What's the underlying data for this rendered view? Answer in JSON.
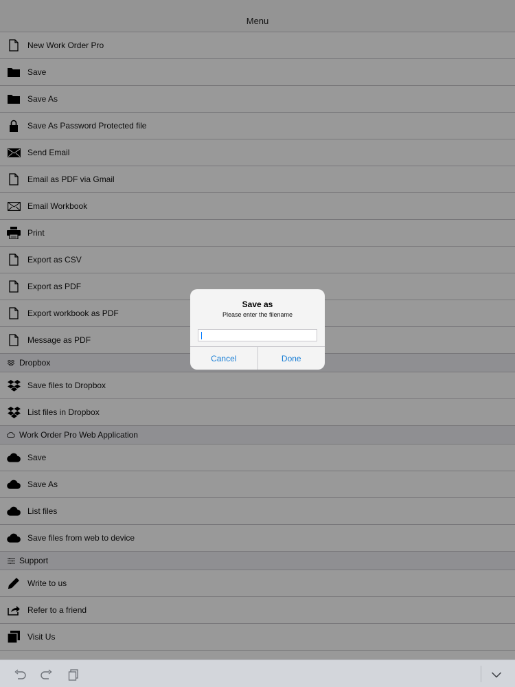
{
  "navbar": {
    "title": "Menu"
  },
  "menu": {
    "items": [
      {
        "label": "New Work Order Pro",
        "icon": "document-icon"
      },
      {
        "label": "Save",
        "icon": "folder-icon"
      },
      {
        "label": "Save As",
        "icon": "folder-icon"
      },
      {
        "label": "Save As Password Protected file",
        "icon": "lock-icon"
      },
      {
        "label": "Send Email",
        "icon": "envelope-filled-icon"
      },
      {
        "label": "Email as PDF via Gmail",
        "icon": "document-icon"
      },
      {
        "label": "Email Workbook",
        "icon": "envelope-outline-icon"
      },
      {
        "label": "Print",
        "icon": "printer-icon"
      },
      {
        "label": "Export as CSV",
        "icon": "document-icon"
      },
      {
        "label": "Export as PDF",
        "icon": "document-icon"
      },
      {
        "label": "Export workbook as PDF",
        "icon": "document-icon"
      },
      {
        "label": "Message as PDF",
        "icon": "document-icon"
      }
    ]
  },
  "dropbox": {
    "header": "Dropbox",
    "items": [
      {
        "label": "Save files to Dropbox",
        "icon": "dropbox-icon"
      },
      {
        "label": "List files in Dropbox",
        "icon": "dropbox-icon"
      }
    ]
  },
  "web": {
    "header": "Work Order Pro Web Application",
    "items": [
      {
        "label": "Save",
        "icon": "cloud-icon"
      },
      {
        "label": "Save As",
        "icon": "cloud-icon"
      },
      {
        "label": "List files",
        "icon": "cloud-icon"
      },
      {
        "label": "Save files from web to device",
        "icon": "cloud-icon"
      }
    ]
  },
  "support": {
    "header": "Support",
    "items": [
      {
        "label": "Write to us",
        "icon": "pencil-icon"
      },
      {
        "label": "Refer to a friend",
        "icon": "share-icon"
      },
      {
        "label": "Visit Us",
        "icon": "copy-icon"
      }
    ]
  },
  "dialog": {
    "title": "Save as",
    "message": "Please enter the filename",
    "input_value": "",
    "cancel_label": "Cancel",
    "done_label": "Done",
    "button_color": "#1a7fd6"
  },
  "toolbar": {
    "icons": [
      "undo-icon",
      "redo-icon",
      "clipboard-icon",
      "chevron-down-icon"
    ]
  }
}
